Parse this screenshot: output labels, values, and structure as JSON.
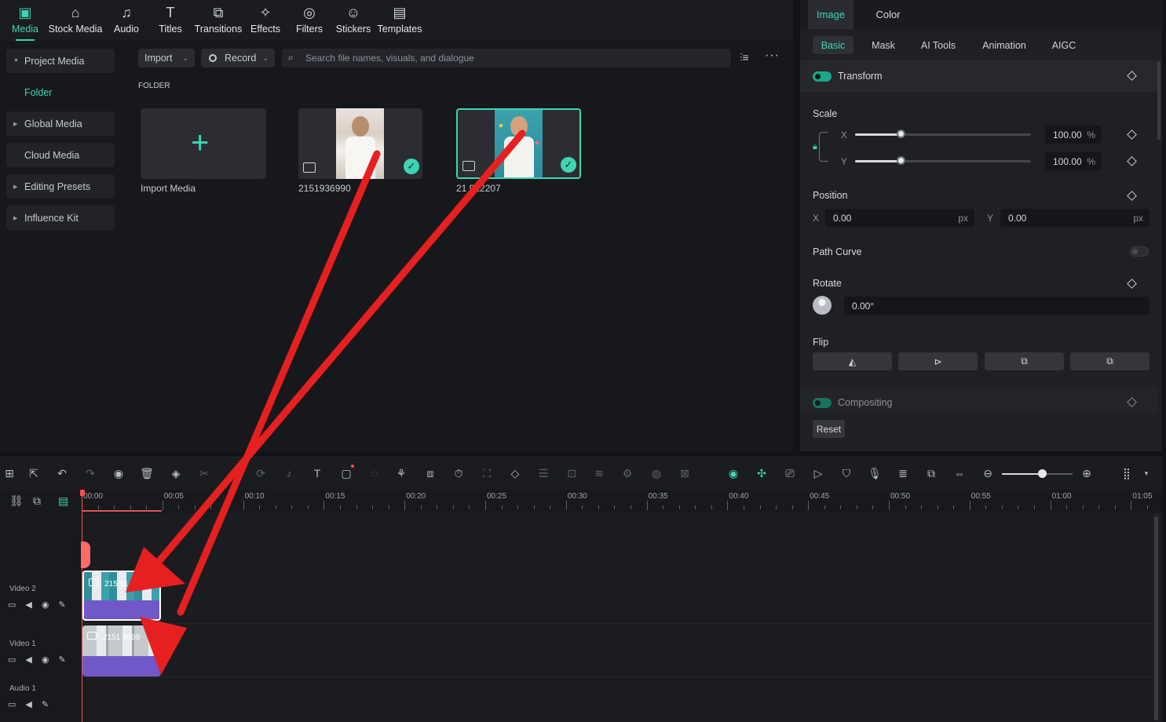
{
  "top_tabs": [
    {
      "label": "Media",
      "icon": "media-icon",
      "glyph": "▣"
    },
    {
      "label": "Stock Media",
      "icon": "stock-media-icon",
      "glyph": "⌂"
    },
    {
      "label": "Audio",
      "icon": "audio-icon",
      "glyph": "♫"
    },
    {
      "label": "Titles",
      "icon": "titles-icon",
      "glyph": "T"
    },
    {
      "label": "Transitions",
      "icon": "transitions-icon",
      "glyph": "⧉"
    },
    {
      "label": "Effects",
      "icon": "effects-icon",
      "glyph": "✧"
    },
    {
      "label": "Filters",
      "icon": "filters-icon",
      "glyph": "◎"
    },
    {
      "label": "Stickers",
      "icon": "stickers-icon",
      "glyph": "☺"
    },
    {
      "label": "Templates",
      "icon": "templates-icon",
      "glyph": "▤"
    }
  ],
  "sidebar": {
    "project_media": "Project Media",
    "folder": "Folder",
    "global_media": "Global Media",
    "cloud_media": "Cloud Media",
    "editing_presets": "Editing Presets",
    "influence_kit": "Influence Kit"
  },
  "media": {
    "import_label": "Import",
    "record_label": "Record",
    "search_placeholder": "Search file names, visuals, and dialogue",
    "folder_heading": "FOLDER",
    "import_media_label": "Import Media",
    "items": [
      {
        "name": "2151936990"
      },
      {
        "name": "21  912207"
      }
    ]
  },
  "inspector": {
    "tabs": [
      "Image",
      "Color"
    ],
    "subtabs": [
      "Basic",
      "Mask",
      "AI Tools",
      "Animation",
      "AIGC"
    ],
    "transform_label": "Transform",
    "scale_label": "Scale",
    "scale_x_axis": "X",
    "scale_y_axis": "Y",
    "scale_x_value": "100.00",
    "scale_y_value": "100.00",
    "percent_unit": "%",
    "position_label": "Position",
    "pos_x_axis": "X",
    "pos_y_axis": "Y",
    "pos_x_value": "0.00",
    "pos_y_value": "0.00",
    "px_unit": "px",
    "path_curve_label": "Path Curve",
    "rotate_label": "Rotate",
    "rotate_value": "0.00°",
    "flip_label": "Flip",
    "compositing_label": "Compositing",
    "reset_label": "Reset"
  },
  "timeline": {
    "ruler_ticks": [
      "00:00",
      "00:05",
      "00:10",
      "00:15",
      "00:20",
      "00:25",
      "00:30",
      "00:35",
      "00:40",
      "00:45",
      "00:50",
      "00:55",
      "01:00",
      "01:05"
    ],
    "tracks": [
      {
        "name": "Video 2"
      },
      {
        "name": "Video 1"
      },
      {
        "name": "Audio 1"
      }
    ],
    "clips": [
      {
        "label": "215 91"
      },
      {
        "label": "2151 3699"
      }
    ]
  },
  "colors": {
    "accent": "#3fd5b4",
    "arrow": "#e62020",
    "clip": "#7058c8",
    "playhead": "#ff4d4d"
  }
}
